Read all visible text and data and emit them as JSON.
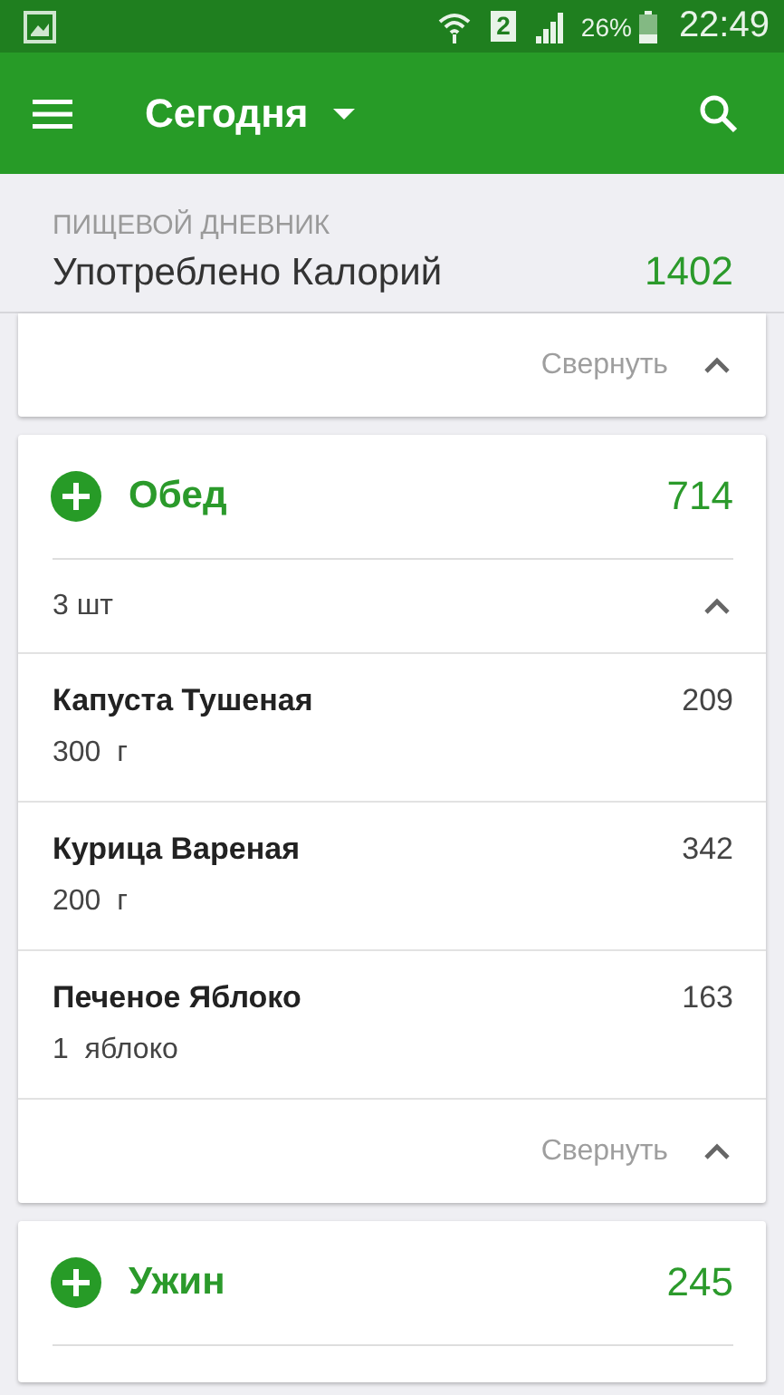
{
  "status_bar": {
    "sim": "2",
    "battery": "26%",
    "time": "22:49"
  },
  "toolbar": {
    "title": "Сегодня"
  },
  "summary": {
    "label": "ПИЩЕВОЙ ДНЕВНИК",
    "title": "Употреблено Калорий",
    "value": "1402"
  },
  "top_card": {
    "collapse_label": "Свернуть"
  },
  "meals": [
    {
      "name": "Обед",
      "calories": "714",
      "expanded": true,
      "count": "3 шт",
      "collapse_label": "Свернуть",
      "items": [
        {
          "name": "Капуста Тушеная",
          "calories": "209",
          "amount": "300  г"
        },
        {
          "name": "Курица Вареная",
          "calories": "342",
          "amount": "200  г"
        },
        {
          "name": "Печеное Яблоко",
          "calories": "163",
          "amount": "1  яблоко"
        }
      ]
    },
    {
      "name": "Ужин",
      "calories": "245",
      "expanded": false
    }
  ]
}
